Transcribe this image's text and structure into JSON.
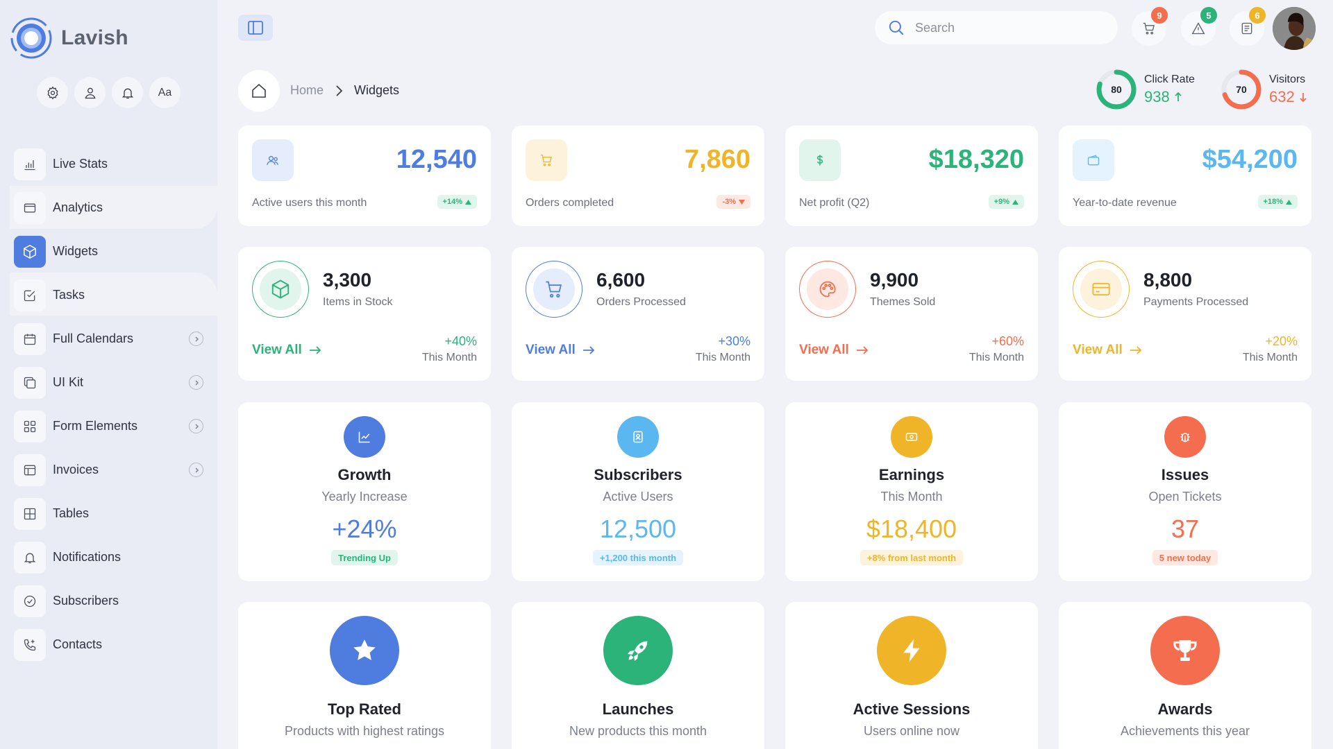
{
  "app": {
    "name": "Lavish"
  },
  "colors": {
    "blue": "#4e7ddf",
    "yellow": "#f0b429",
    "green": "#2cb37a",
    "sky": "#5ab7ef",
    "orange": "#f46d4e",
    "sidebar_bg": "#e9ebf5"
  },
  "sidebar": {
    "quick_actions": [
      {
        "icon": "gear-icon"
      },
      {
        "icon": "user-icon"
      },
      {
        "icon": "bell-icon"
      },
      {
        "label": "Aa",
        "icon": "font-size-icon"
      }
    ],
    "items": [
      {
        "label": "Live Stats",
        "icon": "bar-chart-icon",
        "has_submenu": false,
        "active": false
      },
      {
        "label": "Analytics",
        "icon": "window-icon",
        "has_submenu": false,
        "active": false
      },
      {
        "label": "Widgets",
        "icon": "cube-icon",
        "has_submenu": false,
        "active": true
      },
      {
        "label": "Tasks",
        "icon": "checkbox-icon",
        "has_submenu": false,
        "active": false
      },
      {
        "label": "Full Calendars",
        "icon": "calendar-icon",
        "has_submenu": true,
        "active": false
      },
      {
        "label": "UI Kit",
        "icon": "layers-icon",
        "has_submenu": true,
        "active": false
      },
      {
        "label": "Form Elements",
        "icon": "grid-icon",
        "has_submenu": true,
        "active": false
      },
      {
        "label": "Invoices",
        "icon": "layout-icon",
        "has_submenu": true,
        "active": false
      },
      {
        "label": "Tables",
        "icon": "table-icon",
        "has_submenu": false,
        "active": false
      },
      {
        "label": "Notifications",
        "icon": "bell-icon",
        "has_submenu": false,
        "active": false
      },
      {
        "label": "Subscribers",
        "icon": "check-circle-icon",
        "has_submenu": false,
        "active": false
      },
      {
        "label": "Contacts",
        "icon": "phone-icon",
        "has_submenu": false,
        "active": false
      }
    ]
  },
  "header": {
    "search": {
      "placeholder": "Search",
      "value": ""
    },
    "icons": [
      {
        "icon": "cart-icon",
        "badge": "9",
        "badge_color": "#f46d4e"
      },
      {
        "icon": "alert-icon",
        "badge": "5",
        "badge_color": "#2cb37a"
      },
      {
        "icon": "document-icon",
        "badge": "6",
        "badge_color": "#f0b429"
      }
    ]
  },
  "breadcrumb": {
    "home": "Home",
    "current": "Widgets"
  },
  "mini_kpis": [
    {
      "label": "Click Rate",
      "ring_value": "80",
      "percent": 80,
      "value": "938",
      "trend": "up",
      "color": "#2cb37a"
    },
    {
      "label": "Visitors",
      "ring_value": "70",
      "percent": 70,
      "value": "632",
      "trend": "down",
      "color": "#f46d4e"
    }
  ],
  "stat_cards": [
    {
      "value": "12,540",
      "label": "Active users this month",
      "change": "+14%",
      "trend": "up",
      "icon": "users-icon",
      "color": "#4e7ddf",
      "tint": "#e5ecfb"
    },
    {
      "value": "7,860",
      "label": "Orders completed",
      "change": "-3%",
      "trend": "down",
      "icon": "cart-icon",
      "color": "#f0b429",
      "tint": "#fdf3dc"
    },
    {
      "value": "$18,320",
      "label": "Net profit (Q2)",
      "change": "+9%",
      "trend": "up",
      "icon": "dollar-icon",
      "color": "#2cb37a",
      "tint": "#e1f5ec"
    },
    {
      "value": "$54,200",
      "label": "Year-to-date revenue",
      "change": "+18%",
      "trend": "up",
      "icon": "wallet-icon",
      "color": "#5ab7ef",
      "tint": "#e4f3fd"
    }
  ],
  "summary_cards": [
    {
      "value": "3,300",
      "label": "Items in Stock",
      "link": "View All",
      "change": "+40%",
      "period": "This Month",
      "icon": "box-icon",
      "color": "#2cb37a",
      "tint": "#e1f5ec"
    },
    {
      "value": "6,600",
      "label": "Orders Processed",
      "link": "View All",
      "change": "+30%",
      "period": "This Month",
      "icon": "cart-icon",
      "color": "#4e7ddf",
      "tint": "#e5ecfb"
    },
    {
      "value": "9,900",
      "label": "Themes Sold",
      "link": "View All",
      "change": "+60%",
      "period": "This Month",
      "icon": "palette-icon",
      "color": "#f46d4e",
      "tint": "#fde8e2"
    },
    {
      "value": "8,800",
      "label": "Payments Processed",
      "link": "View All",
      "change": "+20%",
      "period": "This Month",
      "icon": "credit-card-icon",
      "color": "#f0b429",
      "tint": "#fdf3dc"
    }
  ],
  "metric_cards": [
    {
      "title": "Growth",
      "subtitle": "Yearly Increase",
      "value": "+24%",
      "tag": "Trending Up",
      "icon": "trend-chart-icon",
      "color": "#4e7ddf",
      "tag_color": "#2cb37a",
      "tag_bg": "#e1f5ec"
    },
    {
      "title": "Subscribers",
      "subtitle": "Active Users",
      "value": "12,500",
      "tag": "+1,200 this month",
      "icon": "id-badge-icon",
      "color": "#5ab7ef",
      "tag_color": "#5ab7ef",
      "tag_bg": "#e4f3fd"
    },
    {
      "title": "Earnings",
      "subtitle": "This Month",
      "value": "$18,400",
      "tag": "+8% from last month",
      "icon": "cash-icon",
      "color": "#f0b429",
      "tag_color": "#f0b429",
      "tag_bg": "#fdf3dc"
    },
    {
      "title": "Issues",
      "subtitle": "Open Tickets",
      "value": "37",
      "tag": "5 new today",
      "icon": "bug-icon",
      "color": "#f46d4e",
      "tag_color": "#f46d4e",
      "tag_bg": "#fde8e2"
    }
  ],
  "feature_cards": [
    {
      "title": "Top Rated",
      "subtitle": "Products with highest ratings",
      "icon": "star-icon",
      "color": "#4e7ddf"
    },
    {
      "title": "Launches",
      "subtitle": "New products this month",
      "icon": "rocket-icon",
      "color": "#2cb37a"
    },
    {
      "title": "Active Sessions",
      "subtitle": "Users online now",
      "icon": "lightning-icon",
      "color": "#f0b429"
    },
    {
      "title": "Awards",
      "subtitle": "Achievements this year",
      "icon": "trophy-icon",
      "color": "#f46d4e"
    }
  ]
}
